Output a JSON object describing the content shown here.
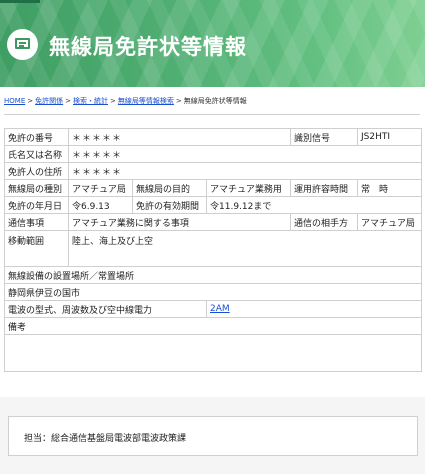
{
  "banner": {
    "title": "無線局免許状等情報",
    "icon": "document-icon"
  },
  "breadcrumb": {
    "home": "HOME",
    "items": [
      "免許関係",
      "検索・統計",
      "無線局等情報検索"
    ],
    "current": "無線局免許状等情報",
    "separator": ">"
  },
  "license": {
    "number_label": "免許の番号",
    "number_value": "＊＊＊＊＊",
    "callsign_label": "識別信号",
    "callsign_value": "JS2HTI",
    "name_label": "氏名又は名称",
    "name_value": "＊＊＊＊＊",
    "address_label": "免許人の住所",
    "address_value": "＊＊＊＊＊",
    "station_type_label": "無線局の種別",
    "station_type_value": "アマチュア局",
    "purpose_label": "無線局の目的",
    "purpose_value": "アマチュア業務用",
    "hours_label": "運用許容時間",
    "hours_value": "常　時",
    "date_label": "免許の年月日",
    "date_value": "令6.9.13",
    "expiry_label": "免許の有効期間",
    "expiry_value": "令11.9.12まで",
    "matter_label": "通信事項",
    "matter_value": "アマチュア業務に関する事項",
    "partner_label": "通信の相手方",
    "partner_value": "アマチュア局",
    "mobile_label": "移動範囲",
    "mobile_value": "陸上、海上及び上空",
    "location_label": "無線設備の設置場所／常置場所",
    "location_value": "静岡県伊豆の国市",
    "emission_label": "電波の型式、周波数及び空中線電力",
    "emission_value": "2AM",
    "remarks_label": "備考"
  },
  "contact": {
    "text": "担当：総合通信基盤局電波部電波政策課"
  }
}
